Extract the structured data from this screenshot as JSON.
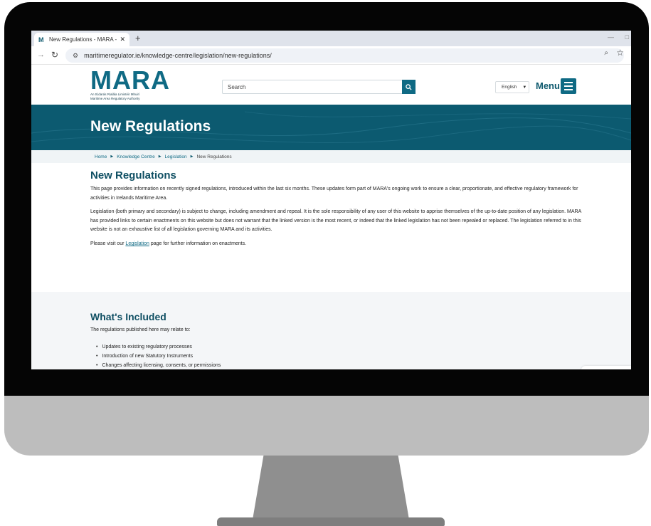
{
  "browser": {
    "tab_title": "New Regulations - MARA - Ma",
    "tab_close": "✕",
    "new_tab": "+",
    "url": "maritimeregulator.ie/knowledge-centre/legislation/new-regulations/"
  },
  "header": {
    "logo_text": "MARA",
    "logo_line1": "An tÚdarás Rialála Limistéir Mhuirí",
    "logo_line2": "Maritime Area Regulatory Authority",
    "search_placeholder": "Search",
    "language": "English",
    "menu_label": "Menu"
  },
  "hero": {
    "title": "New Regulations"
  },
  "breadcrumb": {
    "items": [
      "Home",
      "Knowledge Centre",
      "Legislation"
    ],
    "current": "New Regulations"
  },
  "main": {
    "heading": "New Regulations",
    "para1": "This page provides information on recently signed regulations, introduced within the last six months. These updates form part of MARA's ongoing work to ensure a clear, proportionate, and effective regulatory framework for activities in Irelands Maritime Area.",
    "para2": "Legislation (both primary and secondary) is subject to change, including amendment and repeal. It is the sole responsibility of any user of this website to apprise themselves of the up-to-date position of any legislation. MARA has provided links to certain enactments on this website but does not warrant that the linked version is the most recent, or indeed that the linked legislation has not been repealed or replaced. The legislation referred to in this website is not an exhaustive list of all legislation governing MARA and its activities.",
    "para3_before": "Please visit our ",
    "para3_link": "Legislation",
    "para3_after": " page for further information on enactments."
  },
  "included": {
    "heading": "What's Included",
    "intro": "The regulations published here may relate to:",
    "items": [
      "Updates to existing regulatory processes",
      "Introduction of new Statutory Instruments",
      "Changes affecting licensing, consents, or permissions"
    ]
  },
  "colors": {
    "brand": "#0f6a84",
    "hero_bg": "#0c5a70",
    "heading": "#0f4f63"
  }
}
